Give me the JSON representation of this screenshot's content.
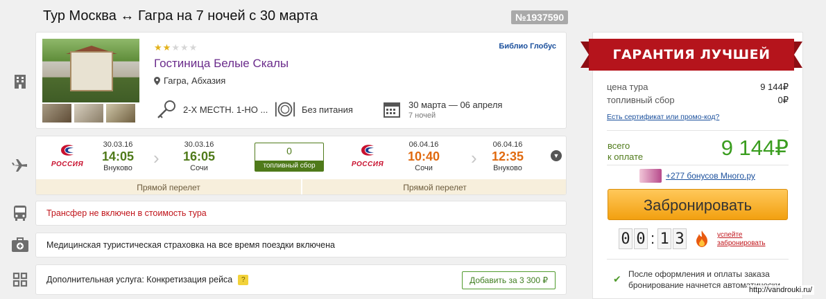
{
  "header": {
    "title": "Тур Москва ↔ Гагра на 7 ночей с 30 марта",
    "tour_number": "№1937590"
  },
  "hotel": {
    "stars_filled": 2,
    "stars_total": 5,
    "name": "Гостиница Белые Скалы",
    "location": "Гагра, Абхазия",
    "operator": "Библио Глобус",
    "room": "2-Х МЕСТН. 1-НО ...",
    "meal": "Без питания",
    "dates": "30 марта — 06 апреля",
    "nights": "7 ночей"
  },
  "flights": {
    "airline_out": "РОССИЯ",
    "airline_back": "РОССИЯ",
    "outbound": {
      "dep_date": "30.03.16",
      "dep_time": "14:05",
      "dep_city": "Внуково",
      "arr_date": "30.03.16",
      "arr_time": "16:05",
      "arr_city": "Сочи",
      "type": "Прямой перелет"
    },
    "fuel": {
      "value": "0",
      "label": "топливный сбор"
    },
    "return": {
      "dep_date": "06.04.16",
      "dep_time": "10:40",
      "dep_city": "Сочи",
      "arr_date": "06.04.16",
      "arr_time": "12:35",
      "arr_city": "Внуково",
      "type": "Прямой перелет"
    }
  },
  "transfer": "Трансфер не включен в стоимость тура",
  "insurance": "Медицинская туристическая страховка на все время поездки включена",
  "service": {
    "label": "Дополнительная услуга: Конкретизация рейса",
    "help": "?",
    "button": "Добавить за 3 300 ₽"
  },
  "panel": {
    "ribbon": "ГАРАНТИЯ ЛУЧШЕЙ ЦЕНЫ",
    "tour_price_label": "цена тура",
    "tour_price": "9 144₽",
    "fuel_label": "топливный сбор",
    "fuel_price": "0₽",
    "promo": "Есть сертификат или промо-код?",
    "total_label_1": "всего",
    "total_label_2": "к оплате",
    "total": "9 144₽",
    "bonus": "+277 бонусов Много.ру",
    "book_button": "Забронировать",
    "timer": [
      "0",
      "0",
      "1",
      "3"
    ],
    "hurry_1": "успейте",
    "hurry_2": "забронировать",
    "note_1": "После оформления и оплаты заказа",
    "note_2": "бронирование начнется автоматически"
  },
  "watermark": "http://vandrouki.ru/",
  "colors": {
    "accent_green": "#4f7a1a",
    "price_green": "#3a9d1f",
    "orange": "#e06a10",
    "ribbon_red": "#b5141c",
    "hotel_purple": "#6a2b8b"
  }
}
